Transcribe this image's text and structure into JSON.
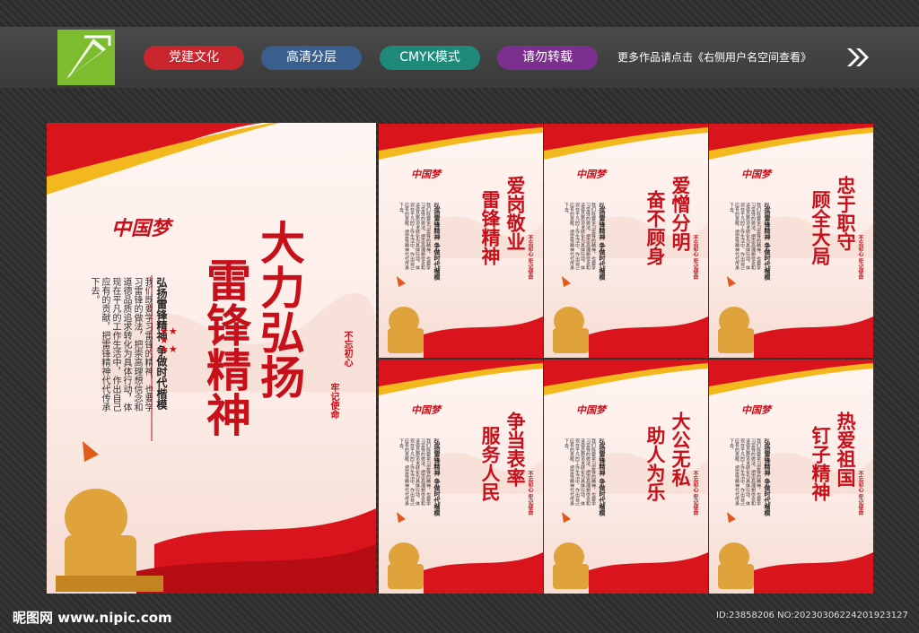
{
  "header": {
    "tags": [
      {
        "label": "党建文化",
        "color": "#c8252e"
      },
      {
        "label": "高清分层",
        "color": "#3a5f8f"
      },
      {
        "label": "CMYK模式",
        "color": "#1f8a7a"
      },
      {
        "label": "请勿转载",
        "color": "#7d2f8f"
      }
    ],
    "more_text": "更多作品请点击《右侧用户名空间查看》"
  },
  "main_poster": {
    "brand": "中国梦",
    "title_line1": "大力弘扬",
    "title_line2": "雷锋精神",
    "slogan": "弘扬雷锋精神  争做时代楷模",
    "seal_left": "不忘初心",
    "seal_right": "牢记使命",
    "body": "我们既要学习雷锋的精神，也要学习雷锋的做法，把崇高理想信念和道德品质追求转化为具体行动，体现在平凡的工作生活中，作出自己应有的贡献，把雷锋精神代代传承下去。"
  },
  "small_posters": [
    {
      "line1": "爱岗敬业",
      "line2": "雷锋精神"
    },
    {
      "line1": "爱憎分明",
      "line2": "奋不顾身"
    },
    {
      "line1": "忠于职守",
      "line2": "顾全大局"
    },
    {
      "line1": "争当表率",
      "line2": "服务人民"
    },
    {
      "line1": "大公无私",
      "line2": "助人为乐"
    },
    {
      "line1": "热爱祖国",
      "line2": "钉子精神"
    }
  ],
  "small_common": {
    "brand": "中国梦",
    "slogan": "弘扬雷锋精神  争做时代楷模",
    "seal": "不忘初心 牢记使命",
    "body": "我们既要学习雷锋的精神，也要学习雷锋的做法，把崇高理想信念和道德品质追求转化为具体行动，体现在平凡的工作生活中，作出自己应有的贡献，把雷锋精神代代传承下去。"
  },
  "footer": {
    "site": "昵图网 www.nipic.com",
    "id_text": "ID:23858206 NO:20230306224201923127"
  }
}
